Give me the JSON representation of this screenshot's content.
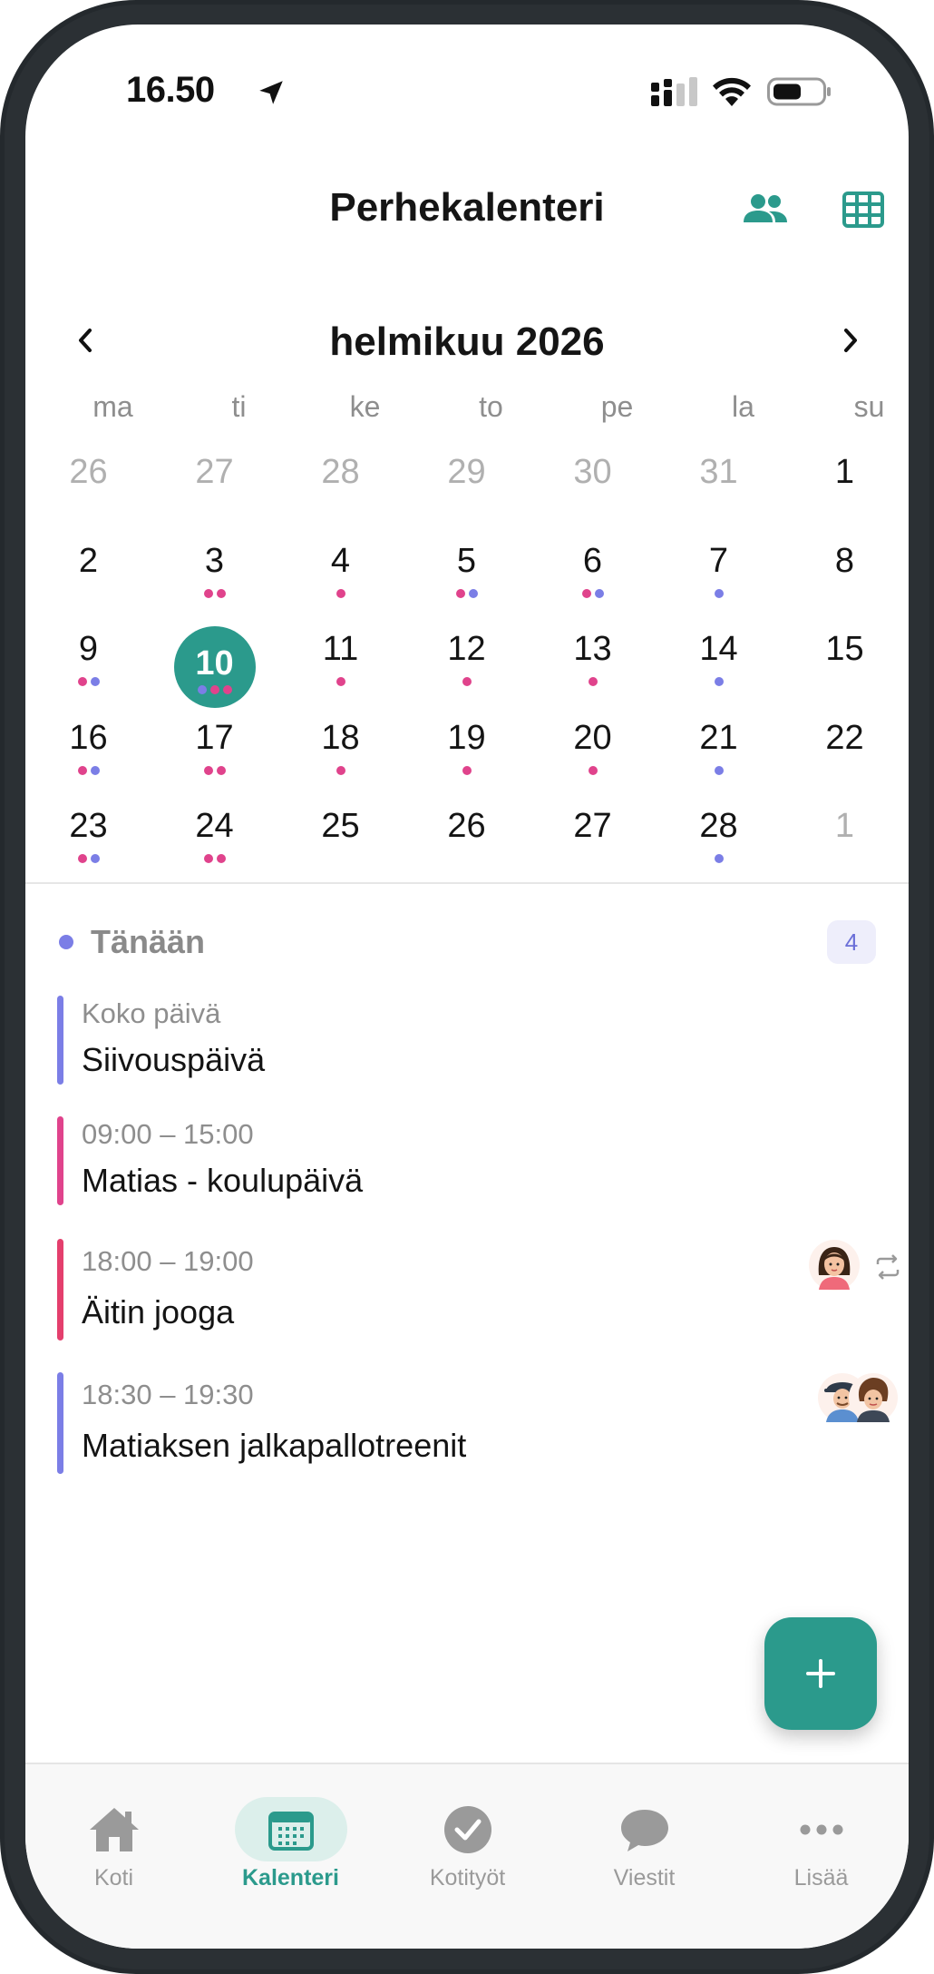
{
  "status_bar": {
    "time": "16.50"
  },
  "header": {
    "title": "Perhekalenteri"
  },
  "calendar": {
    "month_label": "helmikuu 2026",
    "weekdays": [
      "ma",
      "ti",
      "ke",
      "to",
      "pe",
      "la",
      "su"
    ],
    "days": [
      {
        "n": "26",
        "other": true,
        "dots": []
      },
      {
        "n": "27",
        "other": true,
        "dots": []
      },
      {
        "n": "28",
        "other": true,
        "dots": []
      },
      {
        "n": "29",
        "other": true,
        "dots": []
      },
      {
        "n": "30",
        "other": true,
        "dots": []
      },
      {
        "n": "31",
        "other": true,
        "dots": []
      },
      {
        "n": "1",
        "other": false,
        "dots": []
      },
      {
        "n": "2",
        "other": false,
        "dots": []
      },
      {
        "n": "3",
        "other": false,
        "dots": [
          "pink",
          "pink"
        ]
      },
      {
        "n": "4",
        "other": false,
        "dots": [
          "pink"
        ]
      },
      {
        "n": "5",
        "other": false,
        "dots": [
          "pink",
          "purple"
        ]
      },
      {
        "n": "6",
        "other": false,
        "dots": [
          "pink",
          "purple"
        ]
      },
      {
        "n": "7",
        "other": false,
        "dots": [
          "purple"
        ]
      },
      {
        "n": "8",
        "other": false,
        "dots": []
      },
      {
        "n": "9",
        "other": false,
        "dots": [
          "pink",
          "purple"
        ]
      },
      {
        "n": "10",
        "other": false,
        "today": true,
        "dots": [
          "purple",
          "pink",
          "pink"
        ]
      },
      {
        "n": "11",
        "other": false,
        "dots": [
          "pink"
        ]
      },
      {
        "n": "12",
        "other": false,
        "dots": [
          "pink"
        ]
      },
      {
        "n": "13",
        "other": false,
        "dots": [
          "pink"
        ]
      },
      {
        "n": "14",
        "other": false,
        "dots": [
          "purple"
        ]
      },
      {
        "n": "15",
        "other": false,
        "dots": []
      },
      {
        "n": "16",
        "other": false,
        "dots": [
          "pink",
          "purple"
        ]
      },
      {
        "n": "17",
        "other": false,
        "dots": [
          "pink",
          "pink"
        ]
      },
      {
        "n": "18",
        "other": false,
        "dots": [
          "pink"
        ]
      },
      {
        "n": "19",
        "other": false,
        "dots": [
          "pink"
        ]
      },
      {
        "n": "20",
        "other": false,
        "dots": [
          "pink"
        ]
      },
      {
        "n": "21",
        "other": false,
        "dots": [
          "purple"
        ]
      },
      {
        "n": "22",
        "other": false,
        "dots": []
      },
      {
        "n": "23",
        "other": false,
        "dots": [
          "pink",
          "purple"
        ]
      },
      {
        "n": "24",
        "other": false,
        "dots": [
          "pink",
          "pink"
        ]
      },
      {
        "n": "25",
        "other": false,
        "dots": []
      },
      {
        "n": "26",
        "other": false,
        "dots": []
      },
      {
        "n": "27",
        "other": false,
        "dots": []
      },
      {
        "n": "28",
        "other": false,
        "dots": [
          "purple"
        ]
      },
      {
        "n": "1",
        "other": true,
        "dots": []
      }
    ]
  },
  "today": {
    "label": "Tänään",
    "count": "4",
    "events": [
      {
        "time": "Koko päivä",
        "title": "Siivouspäivä",
        "color": "#7b7ee6",
        "avatars": [],
        "repeat": false
      },
      {
        "time": "09:00 – 15:00",
        "title": "Matias - koulupäivä",
        "color": "#e0438c",
        "avatars": [],
        "repeat": false
      },
      {
        "time": "18:00 – 19:00",
        "title": "Äitin jooga",
        "color": "#e43f6d",
        "avatars": [
          "mother-avatar"
        ],
        "repeat": true
      },
      {
        "time": "18:30 – 19:30",
        "title": "Matiaksen jalkapallotreenit",
        "color": "#7b7ee6",
        "avatars": [
          "father-avatar",
          "son-avatar"
        ],
        "repeat": false
      }
    ]
  },
  "tabbar": {
    "tabs": [
      {
        "label": "Koti",
        "icon": "home-icon",
        "active": false
      },
      {
        "label": "Kalenteri",
        "icon": "calendar-icon",
        "active": true
      },
      {
        "label": "Kotityöt",
        "icon": "check-circle-icon",
        "active": false
      },
      {
        "label": "Viestit",
        "icon": "chat-bubble-icon",
        "active": false
      },
      {
        "label": "Lisää",
        "icon": "more-icon",
        "active": false
      }
    ]
  },
  "colors": {
    "accent": "#2b9a8c",
    "dot_pink": "#e0438c",
    "dot_purple": "#7b7ee6"
  }
}
